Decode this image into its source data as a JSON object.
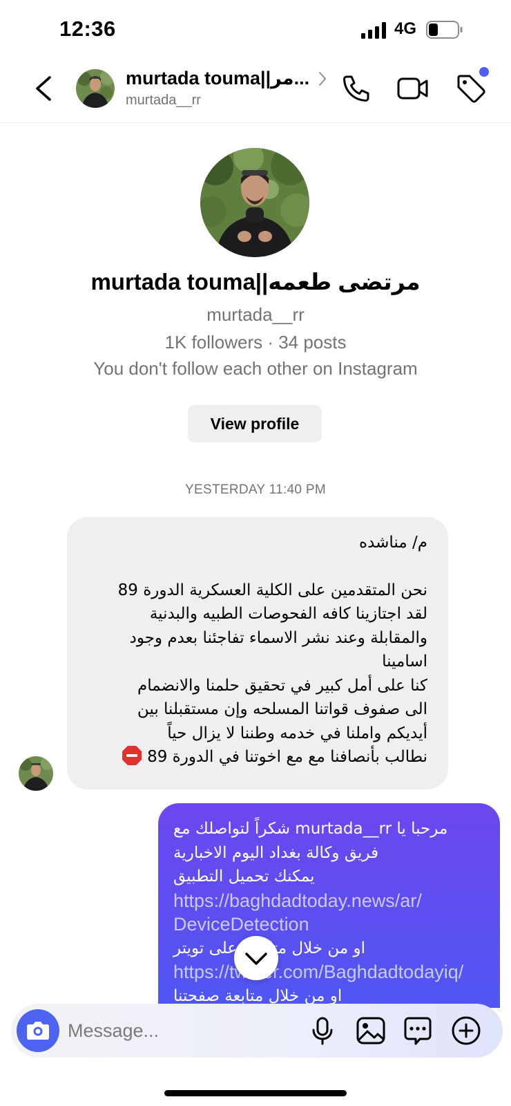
{
  "status_bar": {
    "time": "12:36",
    "network": "4G"
  },
  "header": {
    "display_name": "murtada touma||مر...",
    "username": "murtada__rr"
  },
  "profile": {
    "name": "murtada touma||مرتضى طعمه",
    "username": "murtada__rr",
    "stats": "1K followers · 34 posts",
    "relation": "You don't follow each other on Instagram",
    "view_profile_label": "View profile"
  },
  "conversation": {
    "timestamp": "YESTERDAY 11:40 PM",
    "incoming": {
      "lines": [
        "م/ مناشده",
        "نحن المتقدمين على الكلية العسكرية الدورة 89",
        "لقد اجتازينا كافه الفحوصات الطبيه والبدنية",
        "والمقابلة وعند نشر الاسماء تفاجئنا بعدم وجود",
        "اسامينا",
        "كنا على أمل كبير في تحقيق حلمنا والانضمام",
        "الى صفوف قواتنا المسلحه وإن مستقبلنا بين",
        "أيديكم واملنا في خدمه وطننا لا يزال حياً",
        "نطالب بأنصافنا مع مع اخوتنا في الدورة 89"
      ]
    },
    "outgoing": {
      "line1": "مرحبا يا murtada__rr  شكراً لتواصلك مع",
      "line2": "فريق وكالة بغداد اليوم الاخبارية",
      "line3": "يمكنك تحميل التطبيق",
      "link1_part1": "https://baghdadtoday.news/ar/",
      "link1_part2": "DeviceDetection",
      "line4": "او من خلال متابعتنا على تويتر",
      "link2": "https://twitter.com/Baghdadtodayiq/",
      "line5": "او من خلال متابعة صفحتنا"
    }
  },
  "composer": {
    "placeholder": "Message..."
  },
  "icons": {
    "back": "chevron-left-icon",
    "call": "phone-icon",
    "video": "video-camera-icon",
    "tag": "tag-icon",
    "camera": "camera-icon",
    "mic": "microphone-icon",
    "gallery": "image-icon",
    "sticker": "sticker-icon",
    "plus": "plus-icon",
    "scroll": "chevron-down-icon",
    "stop": "stop-sign-emoji"
  },
  "colors": {
    "accent": "#4c63f0",
    "outgoing_bubble": "#5b4ff0",
    "incoming_bubble": "#efeff1",
    "secondary_text": "#737373"
  }
}
